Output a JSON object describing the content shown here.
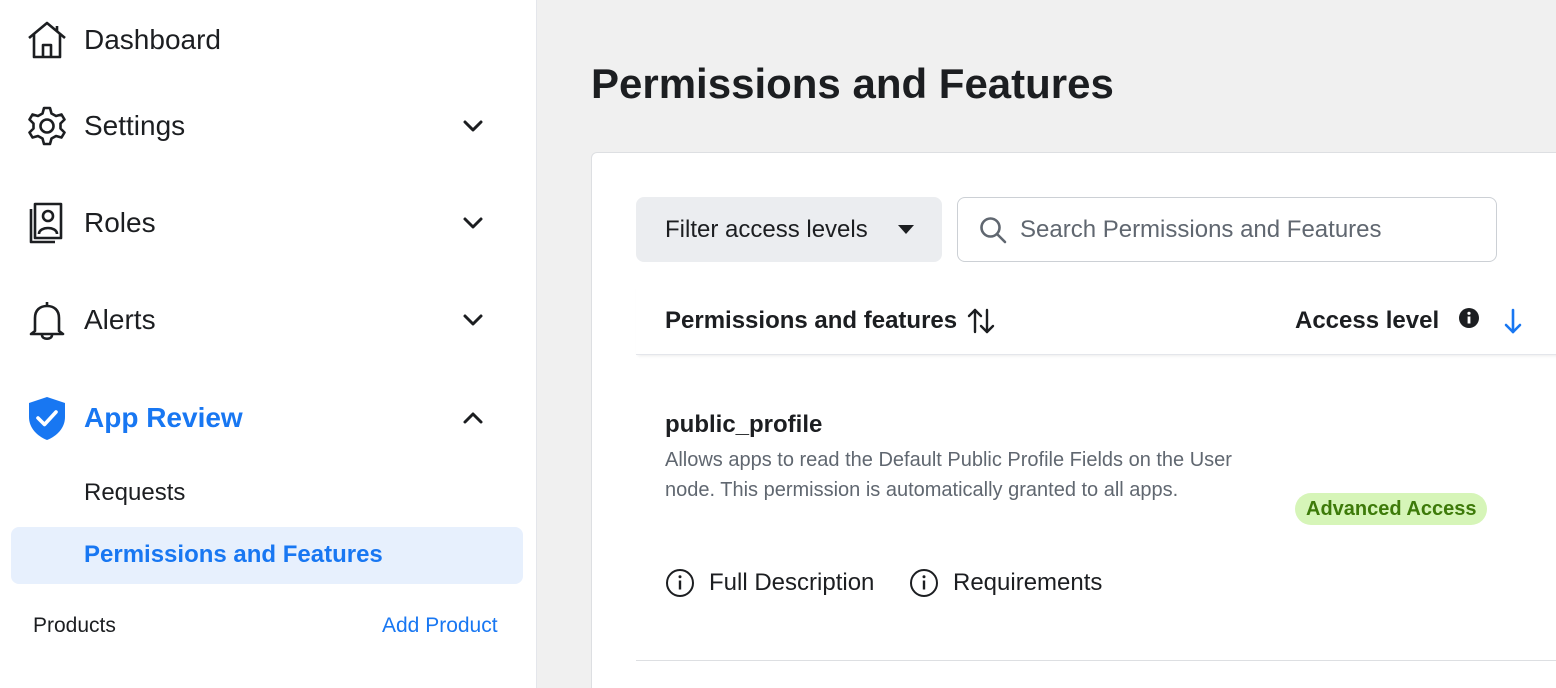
{
  "sidebar": {
    "items": [
      {
        "label": "Dashboard",
        "icon": "home-icon"
      },
      {
        "label": "Settings",
        "icon": "gear-icon",
        "expanded": false
      },
      {
        "label": "Roles",
        "icon": "roles-icon",
        "expanded": false
      },
      {
        "label": "Alerts",
        "icon": "bell-icon",
        "expanded": false
      },
      {
        "label": "App Review",
        "icon": "shield-check-icon",
        "expanded": true,
        "active": true
      }
    ],
    "sub_items": [
      {
        "label": "Requests",
        "selected": false
      },
      {
        "label": "Permissions and Features",
        "selected": true
      }
    ],
    "products_label": "Products",
    "add_product_label": "Add Product"
  },
  "main": {
    "title": "Permissions and Features",
    "filter": {
      "label": "Filter access levels"
    },
    "search": {
      "placeholder": "Search Permissions and Features",
      "value": ""
    },
    "table": {
      "headers": {
        "permission": "Permissions and features",
        "access": "Access level"
      },
      "rows": [
        {
          "name": "public_profile",
          "description": "Allows apps to read the Default Public Profile Fields on the User node. This permission is automatically granted to all apps.",
          "links": [
            "Full Description",
            "Requirements"
          ],
          "access_level": "Advanced Access"
        }
      ]
    }
  },
  "colors": {
    "accent": "#1877f2",
    "badge_bg": "#d6f5b8",
    "badge_text": "#3d7a09",
    "main_bg": "#f0f0f0",
    "selected_bg": "#e7f0fd"
  }
}
